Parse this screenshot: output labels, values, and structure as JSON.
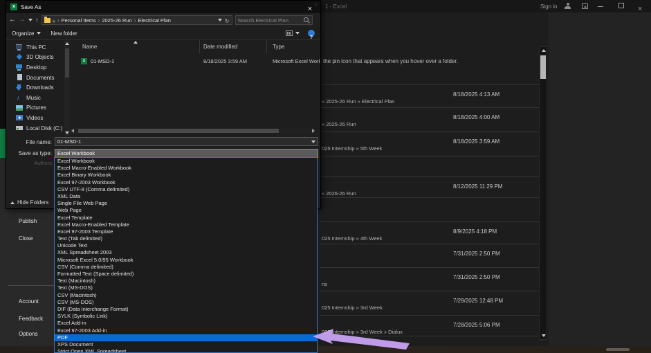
{
  "colors": {
    "accent_blue": "#0a6ad4",
    "excel_green": "#107c41",
    "arrow_purple": "#c9a2f2"
  },
  "backstage": {
    "titlebar": {
      "title": "1 - Excel",
      "sign_in": "Sign in"
    },
    "hint": "the pin icon that appears when you hover over a folder.",
    "recent": [
      {
        "path": "» 2025-26 Run » Electrical Plan",
        "date": "8/18/2025 4:13 AM"
      },
      {
        "path": "» 2025-26 Run",
        "date": "8/18/2025 4:00 AM"
      },
      {
        "path": "025 Internship » 5th Week",
        "date": "8/18/2025 3:59 AM"
      },
      {
        "path": "",
        "date": ""
      },
      {
        "path": "» 2026-26 Run",
        "date": "8/12/2025 11:29 PM"
      },
      {
        "path": "",
        "date": ""
      },
      {
        "path": "025 Internship » 4th Week",
        "date": "8/9/2025 4:18 PM"
      },
      {
        "path": "",
        "date": "7/31/2025 2:50 PM"
      },
      {
        "path": "ns",
        "date": "7/31/2025 2:50 PM"
      },
      {
        "path": "025 Internship » 3rd Week",
        "date": "7/29/2025 12:48 PM"
      },
      {
        "path": "025 Internship » 3rd Week » Dialux",
        "date": "7/28/2025 5:06 PM"
      }
    ],
    "menu": {
      "publish": "Publish",
      "close": "Close",
      "account": "Account",
      "feedback": "Feedback",
      "options": "Options"
    }
  },
  "dialog": {
    "title": "Save As",
    "breadcrumb": [
      "Personal Items",
      "2025-26 Run",
      "Electrical Plan"
    ],
    "search_placeholder": "Search Electrical Plan",
    "toolbar": {
      "organize": "Organize",
      "new_folder": "New folder"
    },
    "places": [
      {
        "label": "This PC",
        "icon": "this-pc-icon"
      },
      {
        "label": "3D Objects",
        "icon": "objects-3d-icon"
      },
      {
        "label": "Desktop",
        "icon": "desktop-icon"
      },
      {
        "label": "Documents",
        "icon": "documents-icon"
      },
      {
        "label": "Downloads",
        "icon": "downloads-icon"
      },
      {
        "label": "Music",
        "icon": "music-icon"
      },
      {
        "label": "Pictures",
        "icon": "pictures-icon"
      },
      {
        "label": "Videos",
        "icon": "videos-icon"
      },
      {
        "label": "Local Disk (C:)",
        "icon": "local-disk-icon"
      }
    ],
    "columns": {
      "name": "Name",
      "date_modified": "Date modified",
      "type": "Type"
    },
    "file": {
      "name": "01-MSD-1",
      "date_modified": "8/18/2025 3:59 AM",
      "type": "Microsoft Excel Work..."
    },
    "file_name": {
      "label": "File name:",
      "value": "01-MSD-1"
    },
    "save_as_type": {
      "label": "Save as type:",
      "value": "Excel Workbook"
    },
    "authors_label": "Authors:",
    "hide_folders": "Hide Folders"
  },
  "dropdown": {
    "selected": "PDF",
    "items": [
      "Excel Workbook",
      "Excel Macro-Enabled Workbook",
      "Excel Binary Workbook",
      "Excel 97-2003 Workbook",
      "CSV UTF-8 (Comma delimited)",
      "XML Data",
      "Single File Web Page",
      "Web Page",
      "Excel Template",
      "Excel Macro-Enabled Template",
      "Excel 97-2003 Template",
      "Text (Tab delimited)",
      "Unicode Text",
      "XML Spreadsheet 2003",
      "Microsoft Excel 5.0/95 Workbook",
      "CSV (Comma delimited)",
      "Formatted Text (Space delimited)",
      "Text (Macintosh)",
      "Text (MS-DOS)",
      "CSV (Macintosh)",
      "CSV (MS-DOS)",
      "DIF (Data Interchange Format)",
      "SYLK (Symbolic Link)",
      "Excel Add-in",
      "Excel 97-2003 Add-in",
      "PDF",
      "XPS Document",
      "Strict Open XML Spreadsheet"
    ]
  }
}
